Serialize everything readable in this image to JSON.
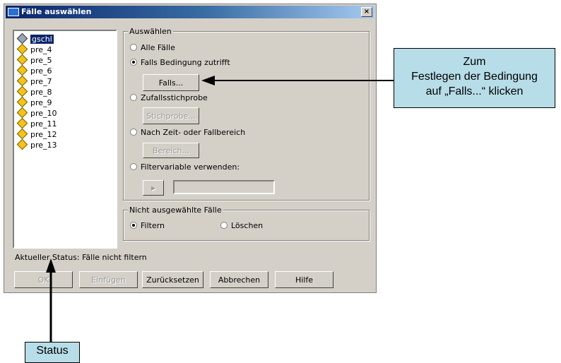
{
  "dialog": {
    "title": "Fälle auswählen",
    "close_label": "×"
  },
  "variables": [
    {
      "name": "gschl",
      "selected": true
    },
    {
      "name": "pre_4"
    },
    {
      "name": "pre_5"
    },
    {
      "name": "pre_6"
    },
    {
      "name": "pre_7"
    },
    {
      "name": "pre_8"
    },
    {
      "name": "pre_9"
    },
    {
      "name": "pre_10"
    },
    {
      "name": "pre_11"
    },
    {
      "name": "pre_12"
    },
    {
      "name": "pre_13"
    }
  ],
  "auswaehlen": {
    "title": "Auswählen",
    "options": [
      {
        "label": "Alle Fälle",
        "checked": false
      },
      {
        "label": "Falls Bedingung zutrifft",
        "checked": true
      },
      {
        "label": "Zufallsstichprobe",
        "checked": false
      },
      {
        "label": "Nach Zeit- oder Fallbereich",
        "checked": false
      },
      {
        "label": "Filtervariable verwenden:",
        "checked": false
      }
    ],
    "falls_button": "Falls...",
    "stichprobe_button": "Stichprobe...",
    "bereich_button": "Bereich...",
    "filter_arrow": "▶",
    "filter_value": ""
  },
  "nicht_ausgewaehlt": {
    "title": "Nicht ausgewählte Fälle",
    "options": [
      {
        "label": "Filtern",
        "checked": true
      },
      {
        "label": "Löschen",
        "checked": false
      }
    ]
  },
  "status_text": "Aktueller Status: Fälle nicht filtern",
  "buttons": {
    "ok": "OK",
    "einfuegen": "Einfügen",
    "zuruecksetzen": "Zurücksetzen",
    "abbrechen": "Abbrechen",
    "hilfe": "Hilfe"
  },
  "callouts": {
    "falls_line1": "Zum",
    "falls_line2": "Festlegen der Bedingung",
    "falls_line3": "auf „Falls...“ klicken",
    "status": "Status"
  },
  "colors": {
    "dialog_bg": "#d4d0c8",
    "titlebar": "#0a246a",
    "callout_bg": "#b7dde8"
  }
}
